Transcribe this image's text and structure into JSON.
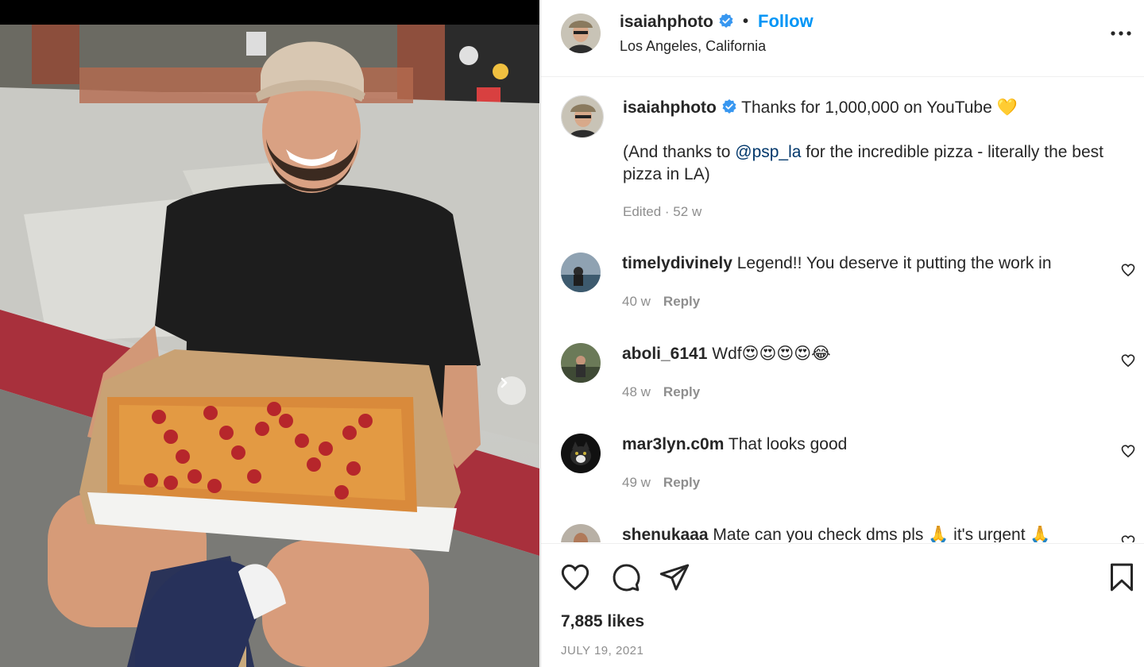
{
  "post": {
    "username": "isaiahphoto",
    "dot": "•",
    "follow_label": "Follow",
    "location": "Los Angeles, California",
    "caption_line1": "Thanks for 1,000,000 on YouTube 💛",
    "caption_pre": "(And thanks to ",
    "caption_mention": "@psp_la",
    "caption_post": " for the incredible pizza - literally the best pizza in LA)",
    "caption_meta": "Edited · 52 w",
    "likes": "7,885 likes",
    "date": "JULY 19, 2021"
  },
  "comments": [
    {
      "username": "timelydivinely",
      "text": "Legend!! You deserve it putting the work in",
      "age": "40 w",
      "reply": "Reply"
    },
    {
      "username": "aboli_6141",
      "text": "Wdf😍😍😍😍😂",
      "age": "48 w",
      "reply": "Reply"
    },
    {
      "username": "mar3lyn.c0m",
      "text": "That looks good",
      "age": "49 w",
      "reply": "Reply"
    },
    {
      "username": "shenukaaa",
      "text": "Mate can you check dms pls 🙏 it's urgent 🙏",
      "age": "",
      "reply": ""
    }
  ],
  "icons": {
    "verified": "verified-badge-icon",
    "more": "more-options-icon",
    "like": "heart-icon",
    "comment": "comment-bubble-icon",
    "share": "paper-plane-icon",
    "save": "bookmark-icon",
    "next": "chevron-right-icon"
  },
  "colors": {
    "accent": "#0095f6",
    "mention": "#00376b",
    "muted": "#8e8e8e",
    "verified": "#3897f0"
  }
}
